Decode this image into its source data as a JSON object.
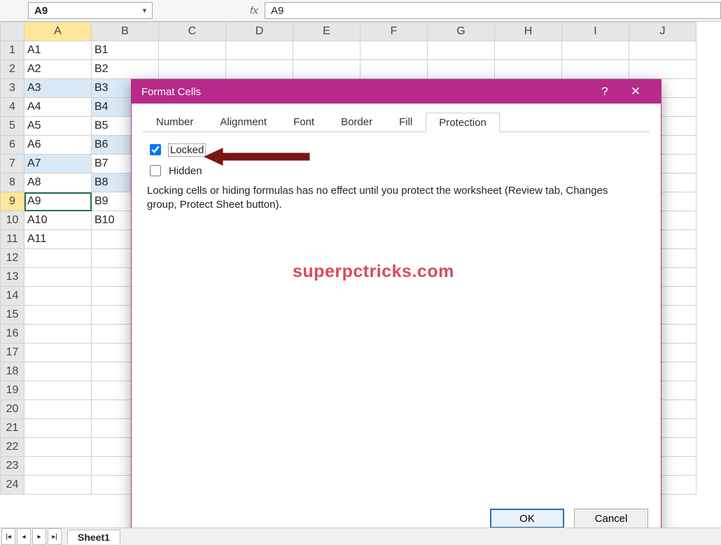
{
  "formula_bar": {
    "name_box": "A9",
    "fx_label": "fx",
    "value": "A9"
  },
  "columns": [
    "A",
    "B",
    "C",
    "D",
    "E",
    "F",
    "G",
    "H",
    "I",
    "J"
  ],
  "rows": [
    {
      "n": 1,
      "A": "A1",
      "B": "B1"
    },
    {
      "n": 2,
      "A": "A2",
      "B": "B2"
    },
    {
      "n": 3,
      "A": "A3",
      "B": "B3",
      "hl": "AB"
    },
    {
      "n": 4,
      "A": "A4",
      "B": "B4",
      "hl": "B"
    },
    {
      "n": 5,
      "A": "A5",
      "B": "B5"
    },
    {
      "n": 6,
      "A": "A6",
      "B": "B6",
      "hl": "B"
    },
    {
      "n": 7,
      "A": "A7",
      "B": "B7",
      "hl": "A"
    },
    {
      "n": 8,
      "A": "A8",
      "B": "B8",
      "hl": "B"
    },
    {
      "n": 9,
      "A": "A9",
      "B": "B9",
      "active": true
    },
    {
      "n": 10,
      "A": "A10",
      "B": "B10"
    },
    {
      "n": 11,
      "A": "A11",
      "B": ""
    },
    {
      "n": 12
    },
    {
      "n": 13
    },
    {
      "n": 14
    },
    {
      "n": 15
    },
    {
      "n": 16
    },
    {
      "n": 17
    },
    {
      "n": 18
    },
    {
      "n": 19
    },
    {
      "n": 20
    },
    {
      "n": 21
    },
    {
      "n": 22
    },
    {
      "n": 23
    },
    {
      "n": 24
    }
  ],
  "active_row": 9,
  "dialog": {
    "title": "Format Cells",
    "help_glyph": "?",
    "close_glyph": "✕",
    "tabs": [
      "Number",
      "Alignment",
      "Font",
      "Border",
      "Fill",
      "Protection"
    ],
    "active_tab": "Protection",
    "locked_label": "Locked",
    "locked_checked": true,
    "hidden_label": "Hidden",
    "hidden_checked": false,
    "info": "Locking cells or hiding formulas has no effect until you protect the worksheet (Review tab, Changes group, Protect Sheet button).",
    "ok": "OK",
    "cancel": "Cancel"
  },
  "watermark": "superpctricks.com",
  "sheet_tabs": {
    "active": "Sheet1",
    "nav": [
      "|◂",
      "◂",
      "▸",
      "▸|"
    ]
  }
}
